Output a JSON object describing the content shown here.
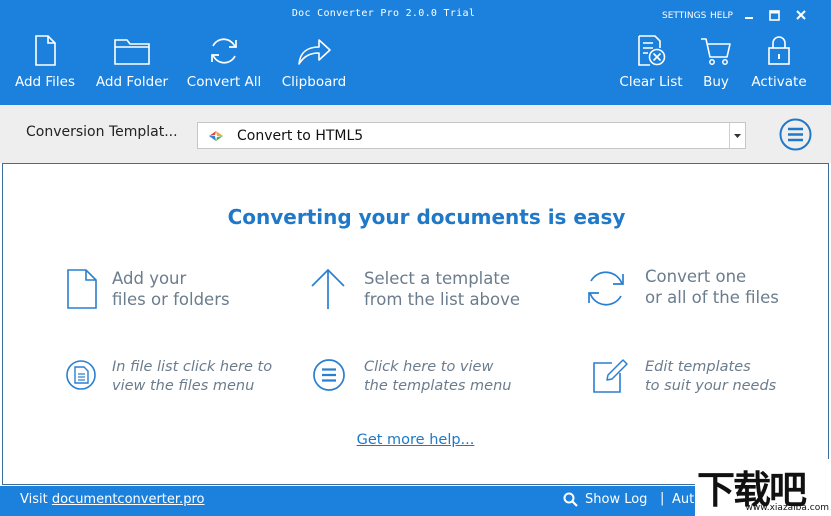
{
  "window": {
    "title": "Doc Converter Pro 2.0.0 Trial",
    "settings": "SETTINGS",
    "help": "HELP"
  },
  "toolbar": {
    "add_files": "Add Files",
    "add_folder": "Add Folder",
    "convert_all": "Convert All",
    "clipboard": "Clipboard",
    "clear_list": "Clear List",
    "buy": "Buy",
    "activate": "Activate"
  },
  "template_bar": {
    "label": "Conversion  Templat...",
    "selected": "Convert to HTML5"
  },
  "main": {
    "headline": "Converting your documents is easy",
    "hints": [
      {
        "line1": "Add your",
        "line2": "files or folders"
      },
      {
        "line1": "Select a template",
        "line2": "from the list above"
      },
      {
        "line1": "Convert one",
        "line2": "or all of the files"
      },
      {
        "line1": "In file list click here to",
        "line2": "view the files menu"
      },
      {
        "line1": "Click here to view",
        "line2": "the templates menu"
      },
      {
        "line1": "Edit templates",
        "line2": "to suit your needs"
      }
    ],
    "help_link": "Get more help..."
  },
  "status": {
    "visit_prefix": "Visit",
    "visit_link": "documentconverter.pro",
    "show_log": "Show Log",
    "separator": "|",
    "auto": "Auto"
  },
  "watermark": {
    "cn": "下载吧",
    "url": "www.xiazaiba.com"
  },
  "colors": {
    "brand_blue": "#1c80dd",
    "headline_blue": "#1f78c8",
    "hint_gray": "#6b7c8d"
  }
}
